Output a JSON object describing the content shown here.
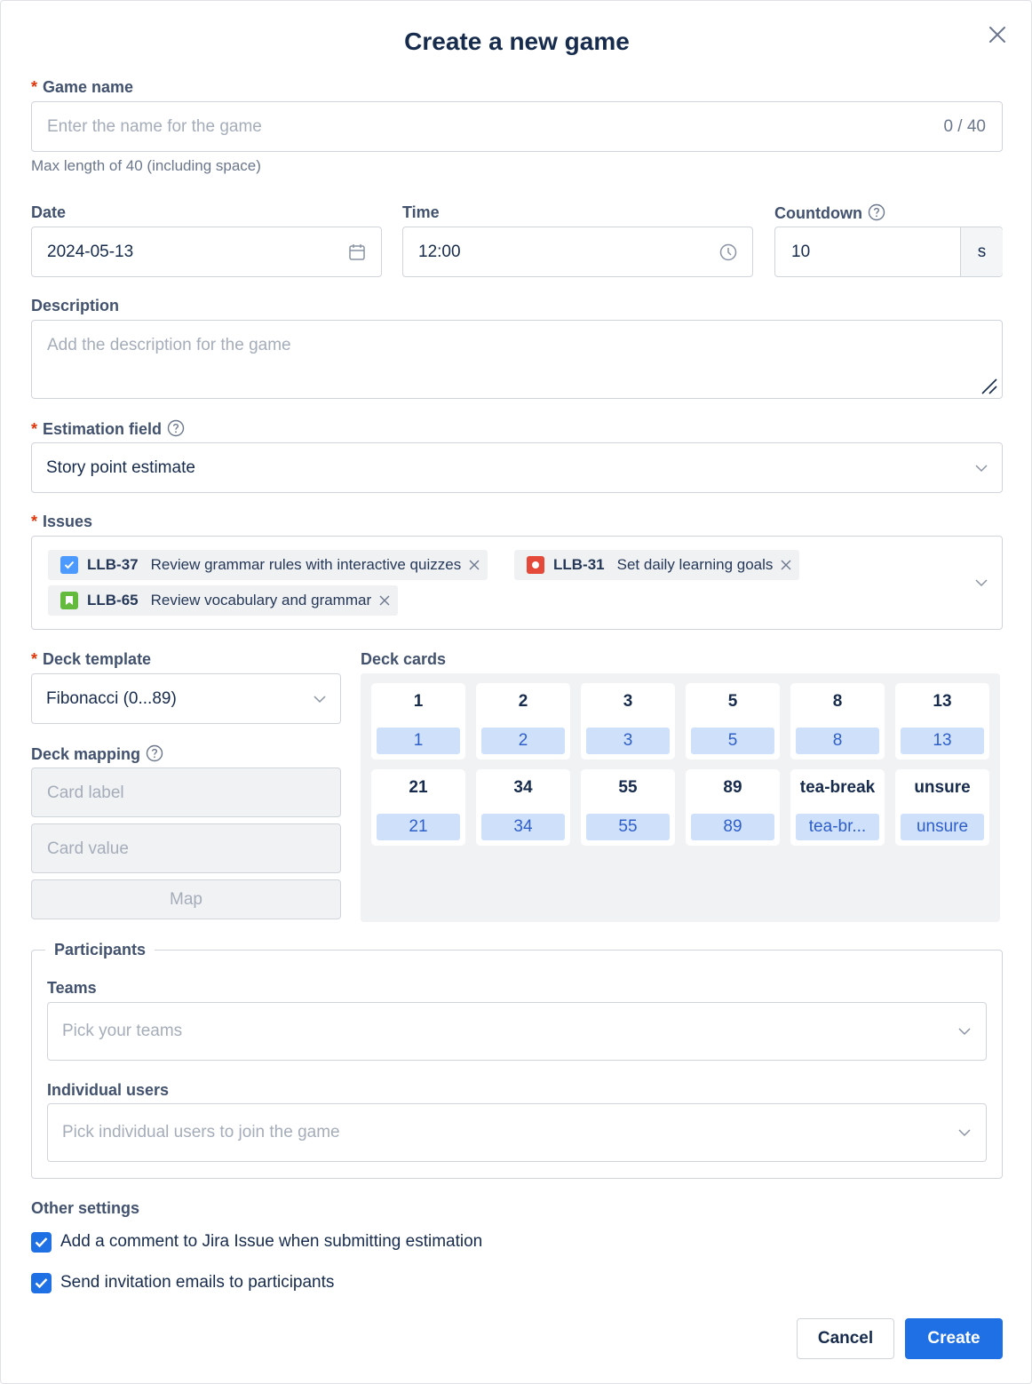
{
  "dialog": {
    "title": "Create a new game"
  },
  "game_name": {
    "label": "Game name",
    "placeholder": "Enter the name for the game",
    "counter": "0 / 40",
    "help": "Max length of 40 (including space)"
  },
  "date": {
    "label": "Date",
    "value": "2024-05-13"
  },
  "time": {
    "label": "Time",
    "value": "12:00"
  },
  "countdown": {
    "label": "Countdown",
    "value": "10",
    "unit": "s"
  },
  "description": {
    "label": "Description",
    "placeholder": "Add the description for the game"
  },
  "estimation_field": {
    "label": "Estimation field",
    "value": "Story point estimate"
  },
  "issues": {
    "label": "Issues",
    "items": [
      {
        "key": "LLB-37",
        "summary": "Review grammar rules with interactive quizzes",
        "type": "task",
        "color": "#4c9aff"
      },
      {
        "key": "LLB-31",
        "summary": "Set daily learning goals",
        "type": "bug",
        "color": "#e5493a"
      },
      {
        "key": "LLB-65",
        "summary": "Review vocabulary and grammar",
        "type": "story",
        "color": "#63ba3c"
      }
    ]
  },
  "deck_template": {
    "label": "Deck template",
    "value": "Fibonacci (0...89)"
  },
  "deck_mapping": {
    "label": "Deck mapping",
    "card_label_placeholder": "Card label",
    "card_value_placeholder": "Card value",
    "map_button": "Map"
  },
  "deck_cards": {
    "label": "Deck cards",
    "cards": [
      {
        "label": "1",
        "value": "1"
      },
      {
        "label": "2",
        "value": "2"
      },
      {
        "label": "3",
        "value": "3"
      },
      {
        "label": "5",
        "value": "5"
      },
      {
        "label": "8",
        "value": "8"
      },
      {
        "label": "13",
        "value": "13"
      },
      {
        "label": "21",
        "value": "21"
      },
      {
        "label": "34",
        "value": "34"
      },
      {
        "label": "55",
        "value": "55"
      },
      {
        "label": "89",
        "value": "89"
      },
      {
        "label": "tea-break",
        "value": "tea-br..."
      },
      {
        "label": "unsure",
        "value": "unsure"
      }
    ]
  },
  "participants": {
    "legend": "Participants",
    "teams_label": "Teams",
    "teams_placeholder": "Pick your teams",
    "users_label": "Individual users",
    "users_placeholder": "Pick individual users to join the game"
  },
  "other_settings": {
    "label": "Other settings",
    "options": [
      {
        "label": "Add a comment to Jira Issue when submitting estimation",
        "checked": true
      },
      {
        "label": "Send invitation emails to participants",
        "checked": true
      }
    ]
  },
  "actions": {
    "cancel": "Cancel",
    "create": "Create"
  },
  "colors": {
    "primary": "#1f6fe5",
    "required": "#de350b",
    "card_value_bg": "#cfe0fb",
    "deck_bg": "#f1f2f4"
  }
}
